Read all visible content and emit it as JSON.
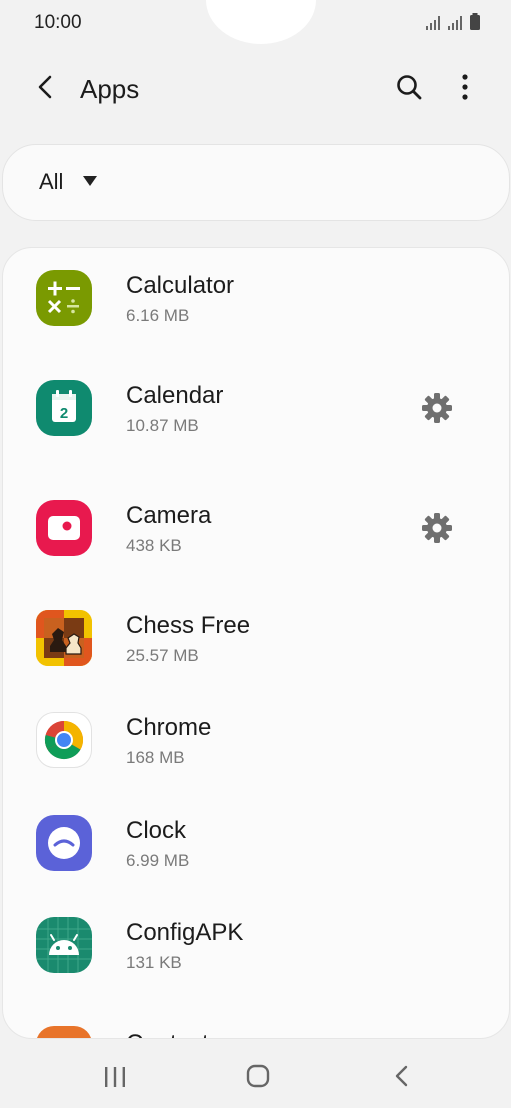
{
  "status_bar": {
    "time": "10:00"
  },
  "header": {
    "title": "Apps"
  },
  "filter": {
    "label": "All"
  },
  "apps": [
    {
      "name": "Calculator",
      "size": "6.16 MB"
    },
    {
      "name": "Calendar",
      "size": "10.87 MB"
    },
    {
      "name": "Camera",
      "size": "438 KB"
    },
    {
      "name": "Chess Free",
      "size": "25.57 MB"
    },
    {
      "name": "Chrome",
      "size": "168 MB"
    },
    {
      "name": "Clock",
      "size": "6.99 MB"
    },
    {
      "name": "ConfigAPK",
      "size": "131 KB"
    },
    {
      "name": "Contacts",
      "size": ""
    }
  ],
  "colors": {
    "calculator": "#7a9a01",
    "calendar": "#0f8a6f",
    "camera": "#e8194e",
    "clock": "#5b62d8",
    "configapk": "#1a8a6e",
    "contacts": "#e8742a"
  }
}
